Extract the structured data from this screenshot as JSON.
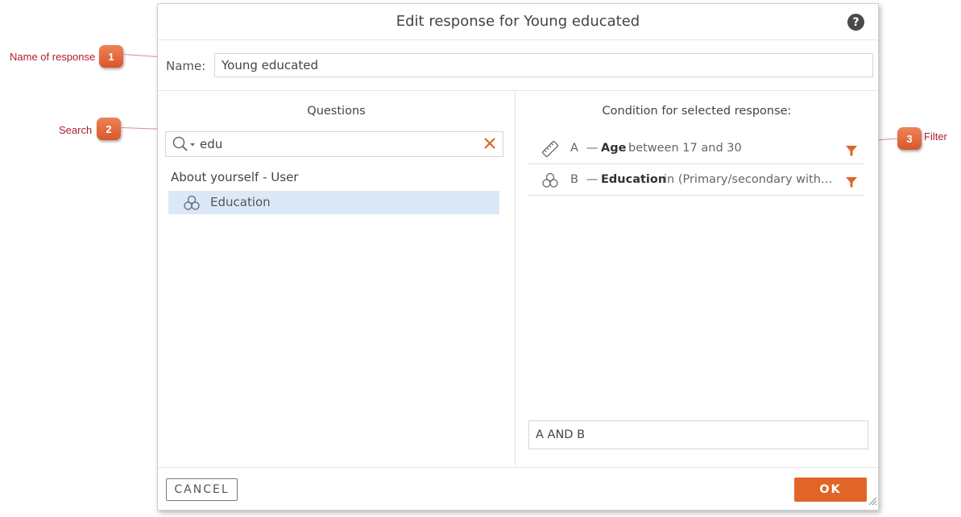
{
  "annotations": [
    {
      "number": "1",
      "label": "Name of response"
    },
    {
      "number": "2",
      "label": "Search"
    },
    {
      "number": "3",
      "label": "Filter"
    }
  ],
  "dialog": {
    "title": "Edit response for Young educated",
    "help_icon": "?",
    "name_label": "Name:",
    "name_value": "Young educated"
  },
  "questions": {
    "title": "Questions",
    "search_value": "edu",
    "group_label": "About yourself - User",
    "results": [
      {
        "label": "Education",
        "icon": "circles-icon",
        "selected": true
      }
    ]
  },
  "conditions": {
    "title": "Condition for selected response:",
    "items": [
      {
        "letter": "A",
        "dash": "—",
        "name": "Age",
        "text": "between 17 and 30",
        "icon": "ruler-icon"
      },
      {
        "letter": "B",
        "dash": "—",
        "name": "Education",
        "text": "in (Primary/secondary without degree, Secondary with degree, University)",
        "icon": "circles-icon"
      }
    ],
    "expression": "A AND B"
  },
  "footer": {
    "cancel_label": "CANCEL",
    "ok_label": "OK"
  },
  "colors": {
    "accent": "#e06526",
    "callout": "#e0663a",
    "callout_text": "#b01c2e",
    "selection": "#dbe8f8"
  }
}
